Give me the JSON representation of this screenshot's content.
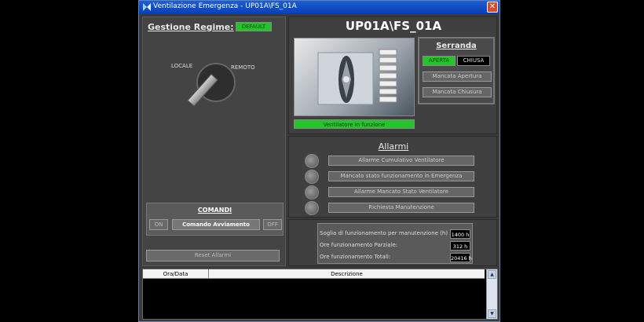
{
  "window": {
    "title": "Ventilazione Emergenza - UP01A\\FS_01A",
    "close_glyph": "✕"
  },
  "left": {
    "regime_label": "Gestione Regime:",
    "regime_badge": "DEFAULT",
    "switch_left_label": "LOCALE",
    "switch_right_label": "REMOTO",
    "commands": {
      "title": "COMANDI",
      "on_label": "ON",
      "start_label": "Comando Avviamento",
      "off_label": "OFF"
    },
    "reset_label": "Reset Allarmi"
  },
  "header": {
    "title": "UP01A\\FS_01A"
  },
  "fan": {
    "status": "Ventilatore in funzione"
  },
  "serranda": {
    "title": "Serranda",
    "open_label": "APERTA",
    "closed_label": "CHIUSA",
    "fail_open_label": "Mancata Apertura",
    "fail_close_label": "Mancata Chiusura"
  },
  "alarms": {
    "title": "Allarmi",
    "items": [
      "Allarme Cumulativo Ventilatore",
      "Mancato stato funzionamento in Emergenza",
      "Allarme Mancato Stato Ventilatore",
      "Richiesta Manutenzione"
    ]
  },
  "counters": {
    "rows": [
      {
        "label": "Soglia di funzionamento per manutenzione (h)",
        "value": "1400 h"
      },
      {
        "label": "Ore funzionamento Parziale:",
        "value": "312 h"
      },
      {
        "label": "Ore funzionamento Totali:",
        "value": "20416 h"
      }
    ]
  },
  "log": {
    "col_date": "Ora/Data",
    "col_desc": "Descrizione",
    "scroll_up": "▲",
    "scroll_down": "▼"
  }
}
